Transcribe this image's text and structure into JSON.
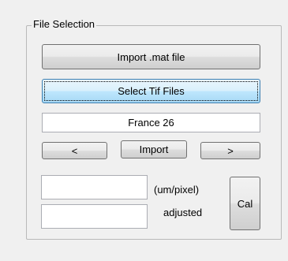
{
  "group": {
    "title": "File Selection"
  },
  "buttons": {
    "import_mat": "Import .mat file",
    "select_tif": "Select Tif Files",
    "prev": "<",
    "import": "Import",
    "next": ">",
    "cal": "Cal"
  },
  "fields": {
    "file_name": "France 26",
    "scale_value": "",
    "adjusted_value": ""
  },
  "labels": {
    "scale_units": "(um/pixel)",
    "adjusted": "adjusted"
  }
}
